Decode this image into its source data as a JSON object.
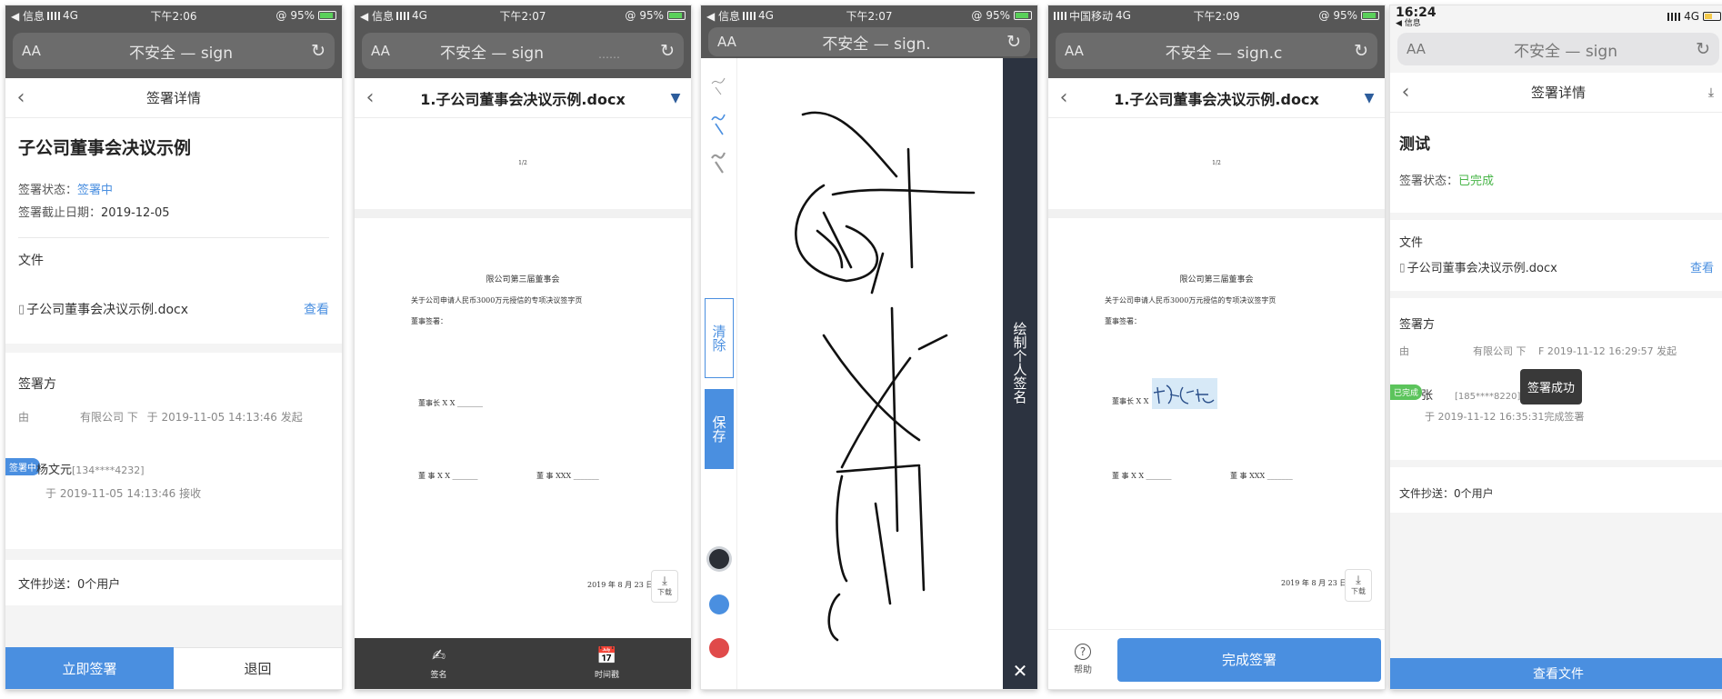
{
  "colors": {
    "accent": "#4a8fe0",
    "success": "#48b548",
    "dark_chrome": "#575757",
    "toolbar": "#3c3c3c",
    "sig_panel": "#2c3340"
  },
  "screens": [
    {
      "status": {
        "carrier": "◀ 信息",
        "network": "4G",
        "time": "下午2:06",
        "battery": "95%"
      },
      "url": {
        "aa": "AA",
        "text": "不安全 — sign"
      },
      "nav": {
        "title": "签署详情"
      },
      "doc": {
        "title": "子公司董事会决议示例",
        "status_label": "签署状态：",
        "status_value": "签署中",
        "deadline_label": "签署截止日期：",
        "deadline_value": "2019-12-05"
      },
      "file": {
        "section": "文件",
        "name": "子公司董事会决议示例.docx",
        "view": "查看"
      },
      "signers": {
        "section": "签署方",
        "from": "由",
        "company": "有限公司 下",
        "initiated": "于 2019-11-05 14:13:46 发起",
        "tag": "签署中",
        "name": "杨文元",
        "phone": "[134****4232]",
        "received": "于 2019-11-05 14:13:46 接收"
      },
      "cc": "文件抄送：0个用户",
      "buttons": {
        "sign_now": "立即签署",
        "back": "退回"
      }
    },
    {
      "status": {
        "carrier": "◀ 信息",
        "network": "4G",
        "time": "下午2:07",
        "battery": "95%"
      },
      "url": {
        "aa": "AA",
        "text": "不安全 — sign",
        "trail": "……"
      },
      "nav": {
        "title": "1.子公司董事会决议示例.docx"
      },
      "doc": {
        "page_no": "1/2",
        "heading": "限公司第三届董事会",
        "line1": "关于公司申请人民币3000万元授信的专项决议签字页",
        "line2": "董事签署：",
        "chair": "董事长 X X _______",
        "director1": "董 事 X X _______",
        "director2": "董 事 XXX _______",
        "date": "2019 年 8 月 23 日"
      },
      "float": {
        "label": "下载"
      },
      "tools": {
        "sign": "签名",
        "timestamp": "时间戳"
      }
    },
    {
      "status": {
        "carrier": "◀ 信息",
        "network": "4G",
        "time": "下午2:07",
        "battery": "95%"
      },
      "url": {
        "aa": "AA",
        "text": "不安全 — sign."
      },
      "pad": {
        "clear": "清除",
        "save": "保存",
        "title": "绘制个人签名",
        "close": "✕"
      }
    },
    {
      "status": {
        "carrier": "中国移动",
        "network": "4G",
        "time": "下午2:09",
        "battery": "95%"
      },
      "url": {
        "aa": "AA",
        "text": "不安全 — sign.c"
      },
      "nav": {
        "title": "1.子公司董事会决议示例.docx"
      },
      "doc": {
        "page_no": "1/2",
        "heading": "限公司第三届董事会",
        "line1": "关于公司申请人民币3000万元授信的专项决议签字页",
        "line2": "董事签署：",
        "chair": "董事长 X X",
        "director1": "董 事 X X _______",
        "director2": "董 事 XXX _______",
        "date": "2019 年 8 月 23 日"
      },
      "float": {
        "label": "下载"
      },
      "actions": {
        "help": "帮助",
        "complete": "完成签署"
      }
    },
    {
      "status": {
        "time": "16:24",
        "back": "◀ 信息",
        "network": "4G"
      },
      "url": {
        "aa": "AA",
        "text": "不安全 — sign"
      },
      "nav": {
        "title": "签署详情"
      },
      "doc": {
        "title": "测试",
        "status_label": "签署状态：",
        "status_value": "已完成"
      },
      "file": {
        "section": "文件",
        "name": "子公司董事会决议示例.docx",
        "view": "查看"
      },
      "signers": {
        "section": "签署方",
        "from": "由",
        "company": "有限公司 下",
        "initiated": "F 2019-11-12 16:29:57 发起",
        "tag": "已完成",
        "name": "张",
        "phone": "[185****8220]",
        "completed": "于 2019-11-12 16:35:31完成签署"
      },
      "toast": "签署成功",
      "cc": "文件抄送：0个用户",
      "buttons": {
        "view_file": "查看文件"
      }
    }
  ]
}
